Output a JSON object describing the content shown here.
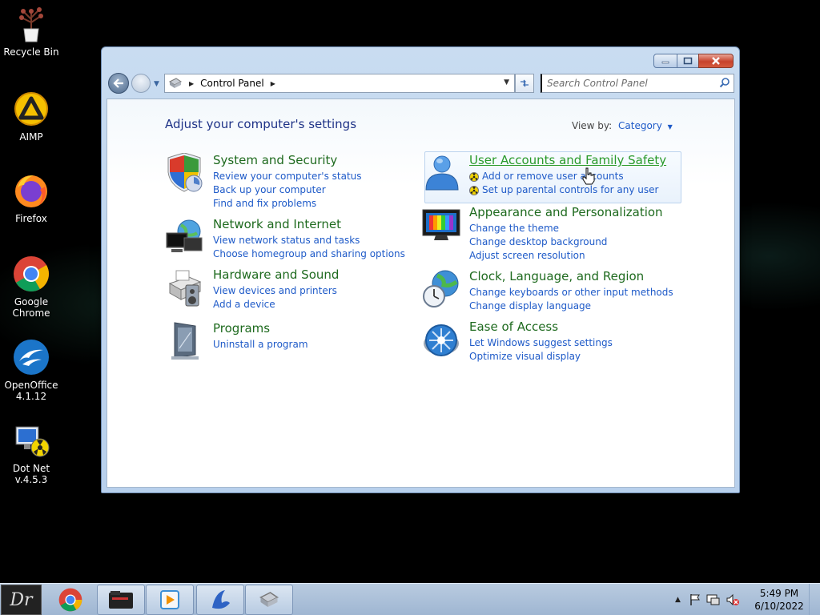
{
  "desktop": {
    "icons": [
      {
        "label": "Recycle Bin",
        "icon": "recycle-bin-plant-icon"
      },
      {
        "label": "AIMP",
        "icon": "aimp-icon"
      },
      {
        "label": "Firefox",
        "icon": "firefox-icon"
      },
      {
        "label": "Google\nChrome",
        "icon": "chrome-icon"
      },
      {
        "label": "OpenOffice\n4.1.12",
        "icon": "openoffice-icon"
      },
      {
        "label": "Dot Net\nv.4.5.3",
        "icon": "dotnet-installer-icon"
      }
    ]
  },
  "window": {
    "address": {
      "crumb": "Control Panel",
      "icon": "control-panel-icon"
    },
    "search": {
      "placeholder": "Search Control Panel"
    },
    "heading": "Adjust your computer's settings",
    "view_by": {
      "label": "View by:",
      "value": "Category"
    },
    "categories": [
      {
        "title": "System and Security",
        "icon": "shield-icon",
        "links": [
          "Review your computer's status",
          "Back up your computer",
          "Find and fix problems"
        ]
      },
      {
        "title": "Network and Internet",
        "icon": "network-icon",
        "links": [
          "View network status and tasks",
          "Choose homegroup and sharing options"
        ]
      },
      {
        "title": "Hardware and Sound",
        "icon": "printer-icon",
        "links": [
          "View devices and printers",
          "Add a device"
        ]
      },
      {
        "title": "Programs",
        "icon": "programs-icon",
        "links": [
          "Uninstall a program"
        ]
      },
      {
        "title": "User Accounts and Family Safety",
        "icon": "user-icon",
        "links": [
          "Add or remove user accounts",
          "Set up parental controls for any user"
        ]
      },
      {
        "title": "Appearance and Personalization",
        "icon": "monitor-icon",
        "links": [
          "Change the theme",
          "Change desktop background",
          "Adjust screen resolution"
        ]
      },
      {
        "title": "Clock, Language, and Region",
        "icon": "clock-globe-icon",
        "links": [
          "Change keyboards or other input methods",
          "Change display language"
        ]
      },
      {
        "title": "Ease of Access",
        "icon": "ease-of-access-icon",
        "links": [
          "Let Windows suggest settings",
          "Optimize visual display"
        ]
      }
    ],
    "colors": {
      "title_green": "#1e6a1e",
      "link_blue": "#1e5ac8",
      "heading_blue": "#1e3287"
    }
  },
  "taskbar": {
    "start_label": "Dr",
    "items": [
      "chrome-icon",
      "folder-icon",
      "media-player-icon",
      "app-icon",
      "control-panel-icon"
    ],
    "clock": {
      "time": "5:49 PM",
      "date": "6/10/2022"
    }
  }
}
